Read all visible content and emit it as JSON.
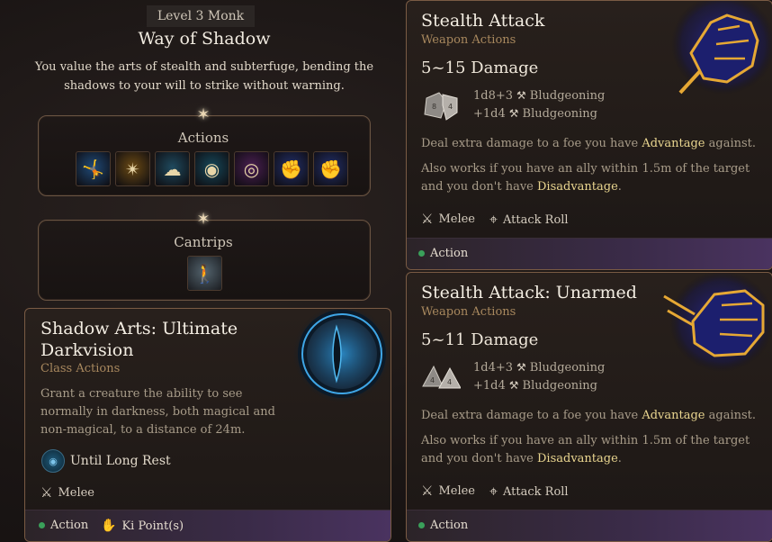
{
  "subclass": {
    "level": "Level 3 Monk",
    "title": "Way of Shadow",
    "description": "You value the arts of stealth and subterfuge, bending the shadows to your will to strike without warning."
  },
  "groups": {
    "actions_label": "Actions",
    "cantrips_label": "Cantrips",
    "actions_icons": [
      {
        "name": "shadow-step-icon",
        "glyph": "🤸",
        "color": "#1f4a78"
      },
      {
        "name": "flurry-icon",
        "glyph": "✴",
        "color": "#6b4a14"
      },
      {
        "name": "shadow-cloud-icon",
        "glyph": "☁",
        "color": "#1f4a5e"
      },
      {
        "name": "darkvision-eye-icon",
        "glyph": "◉",
        "color": "#16485a"
      },
      {
        "name": "pass-without-trace-icon",
        "glyph": "◎",
        "color": "#4a1f52"
      },
      {
        "name": "stealth-attack-icon",
        "glyph": "✊",
        "color": "#23306a"
      },
      {
        "name": "stealth-attack-unarmed-icon",
        "glyph": "✊",
        "color": "#23306a"
      }
    ],
    "cantrip_icon": {
      "name": "minor-illusion-icon",
      "glyph": "🚶",
      "color": "#54646e"
    }
  },
  "shadow_arts": {
    "title": "Shadow Arts: Ultimate Darkvision",
    "subtitle": "Class Actions",
    "description": "Grant a creature the ability to see normally in darkness, both magical and non-magical, to a distance of 24m.",
    "duration": "Until Long Rest",
    "range": "Melee",
    "footer_action": "Action",
    "footer_cost": "Ki Point(s)"
  },
  "stealth_attack": {
    "title": "Stealth Attack",
    "subtitle": "Weapon Actions",
    "damage": "5~15 Damage",
    "dice": [
      {
        "formula": "1d8+3",
        "type": "Bludgeoning"
      },
      {
        "formula": "+1d4",
        "type": "Bludgeoning"
      }
    ],
    "desc1_pre": "Deal extra damage to a foe you have ",
    "desc1_hl": "Advantage",
    "desc1_post": " against.",
    "desc2_pre": "Also works if you have an ally within 1.5m of the target and you don't have ",
    "desc2_hl": "Disadvantage",
    "desc2_post": ".",
    "range": "Melee",
    "roll": "Attack Roll",
    "footer_action": "Action"
  },
  "stealth_attack_unarmed": {
    "title": "Stealth Attack: Unarmed",
    "subtitle": "Weapon Actions",
    "damage": "5~11 Damage",
    "dice": [
      {
        "formula": "1d4+3",
        "type": "Bludgeoning"
      },
      {
        "formula": "+1d4",
        "type": "Bludgeoning"
      }
    ],
    "desc1_pre": "Deal extra damage to a foe you have ",
    "desc1_hl": "Advantage",
    "desc1_post": " against.",
    "desc2_pre": "Also works if you have an ally within 1.5m of the target and you don't have ",
    "desc2_hl": "Disadvantage",
    "desc2_post": ".",
    "range": "Melee",
    "roll": "Attack Roll",
    "footer_action": "Action"
  },
  "colors": {
    "highlight": "#e9d58f",
    "action_dot": "#3aa05a",
    "ki_blue": "#3a8fe0",
    "card_border": "#7a5b44"
  }
}
